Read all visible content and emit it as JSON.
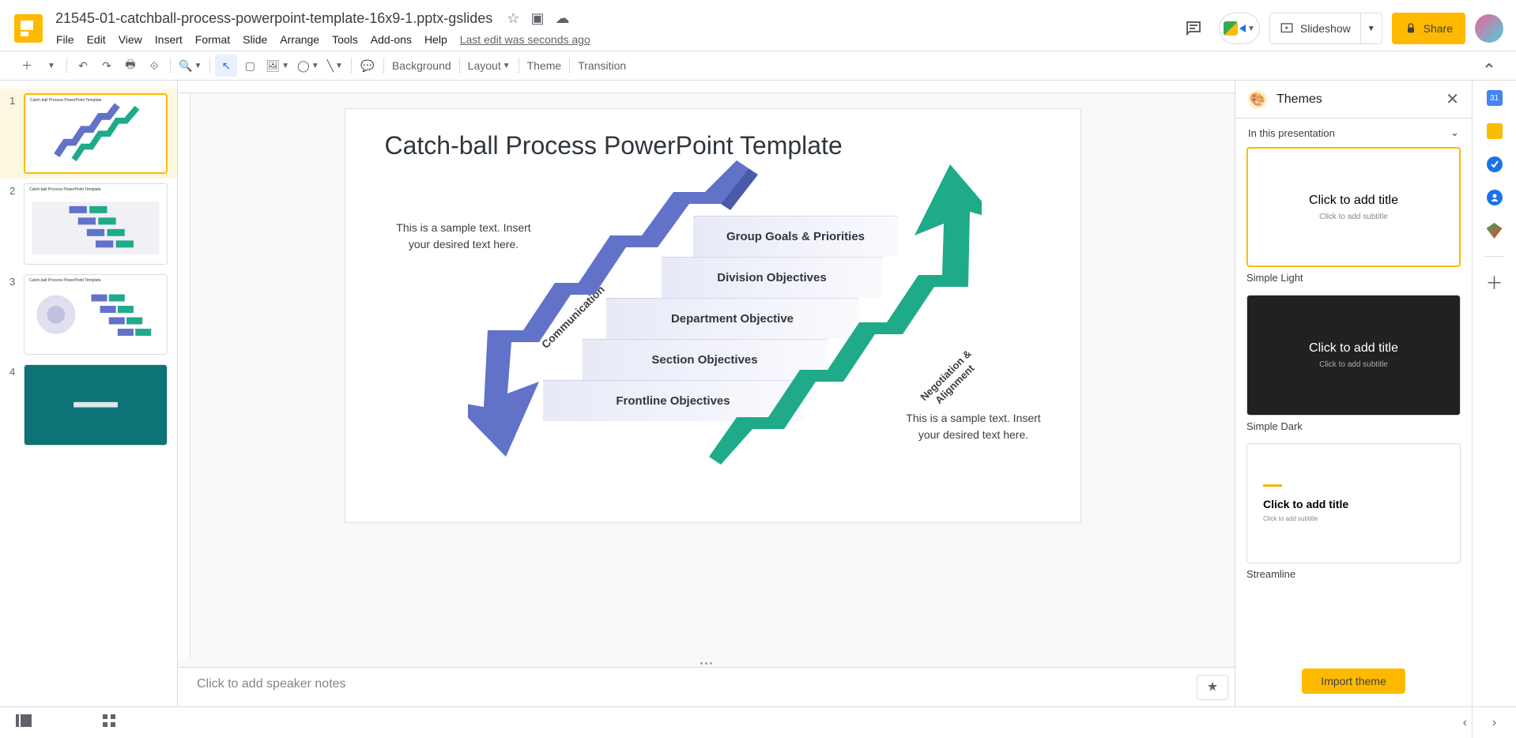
{
  "header": {
    "title": "21545-01-catchball-process-powerpoint-template-16x9-1.pptx-gslides",
    "lastEdit": "Last edit was seconds ago",
    "menus": [
      "File",
      "Edit",
      "View",
      "Insert",
      "Format",
      "Slide",
      "Arrange",
      "Tools",
      "Add-ons",
      "Help"
    ],
    "slideshow": "Slideshow",
    "share": "Share"
  },
  "toolbar": {
    "background": "Background",
    "layout": "Layout",
    "theme": "Theme",
    "transition": "Transition"
  },
  "filmstrip": {
    "thumbs": [
      {
        "title": "Catch-ball Process PowerPoint Template"
      },
      {
        "title": "Catch-ball Process PowerPoint Template"
      },
      {
        "title": "Catch-ball Process PowerPoint Template"
      },
      {
        "title": ""
      }
    ]
  },
  "slide": {
    "title": "Catch-ball Process PowerPoint Template",
    "sampleLeft": "This is a sample text. Insert your desired text here.",
    "sampleRight": "This is a sample text. Insert your desired text here.",
    "comm": "Communication",
    "neg1": "Negotiation &",
    "neg2": "Alignment",
    "bands": [
      "Group Goals & Priorities",
      "Division Objectives",
      "Department Objective",
      "Section Objectives",
      "Frontline Objectives"
    ]
  },
  "notes": {
    "placeholder": "Click to add speaker notes"
  },
  "themes": {
    "title": "Themes",
    "sectionHdr": "In this presentation",
    "clickTitle": "Click to add title",
    "clickSub": "Click to add subtitle",
    "items": [
      "Simple Light",
      "Simple Dark",
      "Streamline"
    ],
    "import": "Import theme"
  },
  "sidepanel": {
    "cal": "31"
  }
}
